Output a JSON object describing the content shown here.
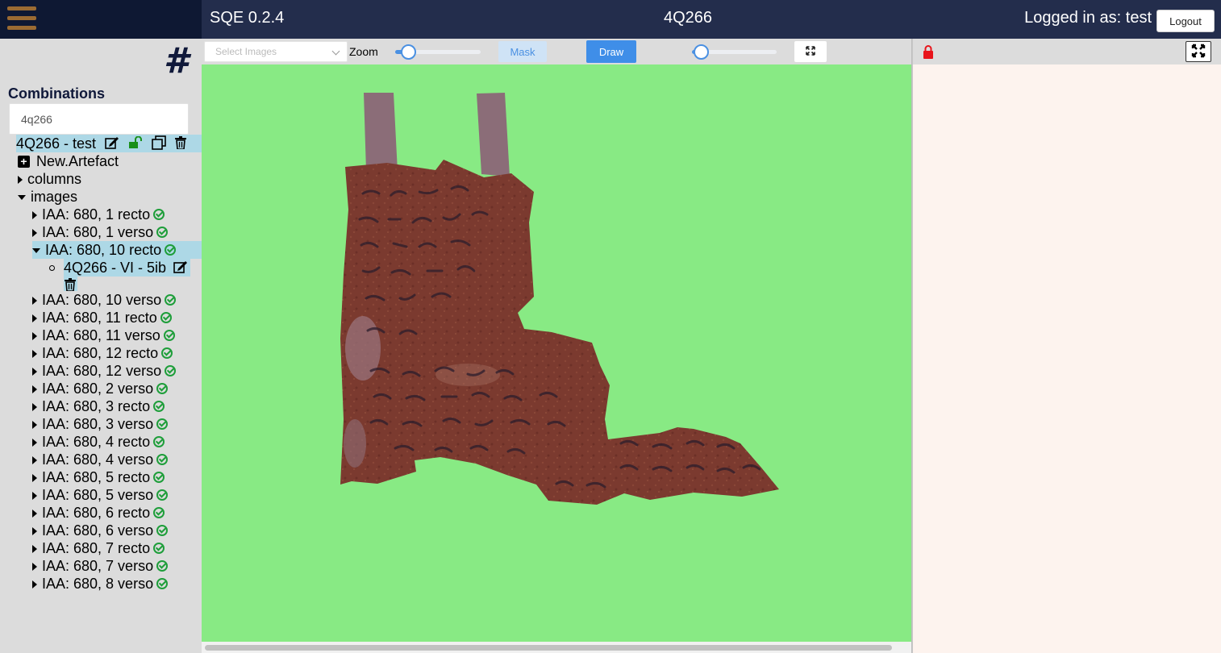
{
  "header": {
    "app_title": "SQE 0.2.4",
    "scroll_title": "4Q266",
    "login_text": "Logged in as: test",
    "logout_label": "Logout"
  },
  "sidebar": {
    "combinations_title": "Combinations",
    "search_value": "4q266",
    "combination_label": "4Q266 - test",
    "new_artefact_label": "New.Artefact",
    "columns_label": "columns",
    "images_label": "images",
    "images": [
      {
        "label": "IAA: 680, 1 recto"
      },
      {
        "label": "IAA: 680, 1 verso"
      },
      {
        "label": "IAA: 680, 10 recto"
      },
      {
        "label": "IAA: 680, 10 verso"
      },
      {
        "label": "IAA: 680, 11 recto"
      },
      {
        "label": "IAA: 680, 11 verso"
      },
      {
        "label": "IAA: 680, 12 recto"
      },
      {
        "label": "IAA: 680, 12 verso"
      },
      {
        "label": "IAA: 680, 2 verso"
      },
      {
        "label": "IAA: 680, 3 recto"
      },
      {
        "label": "IAA: 680, 3 verso"
      },
      {
        "label": "IAA: 680, 4 recto"
      },
      {
        "label": "IAA: 680, 4 verso"
      },
      {
        "label": "IAA: 680, 5 recto"
      },
      {
        "label": "IAA: 680, 5 verso"
      },
      {
        "label": "IAA: 680, 6 recto"
      },
      {
        "label": "IAA: 680, 6 verso"
      },
      {
        "label": "IAA: 680, 7 recto"
      },
      {
        "label": "IAA: 680, 7 verso"
      },
      {
        "label": "IAA: 680, 8 verso"
      }
    ],
    "artefact_label": "4Q266 - VI - 5ib"
  },
  "toolbar": {
    "select_images_placeholder": "Select Images",
    "zoom_label": "Zoom",
    "zoom_level": 0.15,
    "mask_label": "Mask",
    "draw_label": "Draw",
    "opacity_level": 0.1
  },
  "colors": {
    "header_bg": "#232d4c",
    "canvas_bg": "#88ea84",
    "highlight": "#add8e6",
    "ok_green": "#1e9e3a",
    "draw_blue": "#3f8ee8",
    "lock_red": "#e8141b",
    "right_panel_bg": "#fdf3ee"
  },
  "icons": [
    "hamburger-icon",
    "hash-icon",
    "edit-icon",
    "unlock-icon",
    "copy-icon",
    "trash-icon",
    "plus-square-icon",
    "check-circle-icon",
    "expand-icon",
    "lock-icon",
    "maximize-icon"
  ]
}
